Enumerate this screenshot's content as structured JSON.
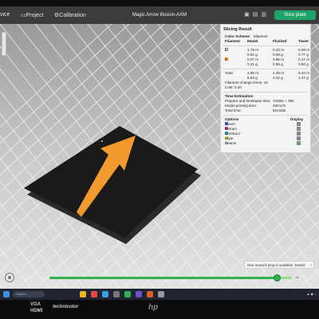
{
  "app": {
    "title": "Magic Arrow  Illusion-AXM",
    "tabs": [
      "vice",
      "Project",
      "Calibration"
    ],
    "slice_button": "Slice plate"
  },
  "panel": {
    "header": "Slicing Result",
    "color_scheme_label": "Color Scheme",
    "color_scheme_value": "Filament",
    "columns": [
      "Filament",
      "Model",
      "Flushed",
      "Tower"
    ],
    "rows": [
      {
        "id": "1",
        "color": "#f0f0f0",
        "model": "1.78 m\n0.52 g",
        "model_l": "1.78 m",
        "model_g": "0.52 g",
        "flushed_l": "0.22 m",
        "flushed_g": "0.66 g",
        "tower_l": "0.26 m",
        "tower_g": "0.77 g"
      },
      {
        "id": "2",
        "color": "#f08a1d",
        "model_l": "0.07 m",
        "model_g": "0.21 g",
        "flushed_l": "0.86 m",
        "flushed_g": "2.56 g",
        "tower_l": "0.17 m",
        "tower_g": "0.50 g"
      }
    ],
    "total_label": "Total",
    "total_model_l": "1.85 m",
    "total_model_g": "5.53 g",
    "total_flushed_l": "1.08 m",
    "total_flushed_g": "3.22 g",
    "total_tower_l": "0.43 m",
    "total_tower_g": "1.27 g",
    "filament_changes": "Filament change times:  10",
    "cost": "Cost:  0.20",
    "time_header": "Time Estimation",
    "time_rows": [
      {
        "label": "Prepare and timelapse time:",
        "value": "7m50s + 38s"
      },
      {
        "label": "Model printing time:",
        "value": "43m17s"
      },
      {
        "label": "Total time:",
        "value": "51m4ds"
      }
    ],
    "options_header": "Options",
    "display_header": "Display",
    "options": [
      {
        "label": "Travel",
        "color": "#3b6fd8"
      },
      {
        "label": "Retract",
        "color": "#d63c9a"
      },
      {
        "label": "Unretract",
        "color": "#2c9bd6"
      },
      {
        "label": "Wipe",
        "color": "#e0d23a"
      },
      {
        "label": "Seams",
        "color": "#c8c8c8"
      }
    ]
  },
  "notification": "New network plug-in available.  Details",
  "progress": {
    "fraction": 0.94,
    "label": "54"
  },
  "taskbar": {
    "search": "Search"
  },
  "stickers": [
    "VGA",
    "HDMI",
    "technicolor",
    "hp"
  ],
  "colors": {
    "accent": "#1fa46a",
    "arrow": "#f29a2e",
    "plate": "#1a1a1a"
  }
}
